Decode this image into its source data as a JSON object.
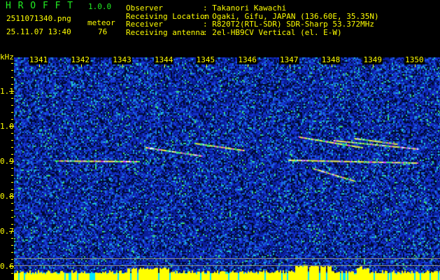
{
  "header": {
    "app_name": "H R O F F T",
    "version": "1.0.0",
    "filename": "2511071340.png",
    "datetime": "25.11.07 13:40",
    "meteor_label": "meteor",
    "meteor_count": "76",
    "info": [
      {
        "label": "Observer",
        "value": ": Takanori Kawachi"
      },
      {
        "label": "Receiving Location",
        "value": ": Ogaki, Gifu, JAPAN (136.60E, 35.35N)"
      },
      {
        "label": "Receiver",
        "value": ": R820T2(RTL-SDR) SDR-Sharp 53.372MHz"
      },
      {
        "label": "Receiving antenna",
        "value": ": 2el-HB9CV Vertical (el. E-W)"
      }
    ]
  },
  "colors": {
    "text": "#ffff00",
    "title": "#22ee22",
    "noise": "#1030c0",
    "signal": "#ffff00",
    "level_bg": "#00e5ff"
  },
  "chart_data": {
    "type": "heatmap",
    "title": "",
    "ylabel": "kHz",
    "xlabel": "",
    "x_ticks": [
      "1341",
      "1342",
      "1343",
      "1344",
      "1345",
      "1346",
      "1347",
      "1348",
      "1349",
      "1350"
    ],
    "y_ticks": [
      "1.1",
      "1.0",
      "0.9",
      "0.8",
      "0.7",
      "0.6"
    ],
    "xlim": [
      1340.4,
      1350.6
    ],
    "ylim": [
      0.56,
      1.196
    ],
    "reference_lines_khz": [
      0.602,
      0.622
    ],
    "meteor_traces": [
      {
        "t": [
          1341.38,
          1343.38
        ],
        "f": [
          0.902,
          0.9
        ]
      },
      {
        "t": [
          1343.55,
          1344.88
        ],
        "f": [
          0.94,
          0.916
        ]
      },
      {
        "t": [
          1344.72,
          1345.88
        ],
        "f": [
          0.952,
          0.932
        ]
      },
      {
        "t": [
          1346.97,
          1350.05
        ],
        "f": [
          0.904,
          0.896
        ]
      },
      {
        "t": [
          1347.22,
          1348.72
        ],
        "f": [
          0.97,
          0.94
        ]
      },
      {
        "t": [
          1348.05,
          1350.05
        ],
        "f": [
          0.96,
          0.936
        ]
      },
      {
        "t": [
          1348.55,
          1349.55
        ],
        "f": [
          0.966,
          0.95
        ]
      },
      {
        "t": [
          1347.55,
          1348.55
        ],
        "f": [
          0.88,
          0.844
        ]
      }
    ]
  }
}
